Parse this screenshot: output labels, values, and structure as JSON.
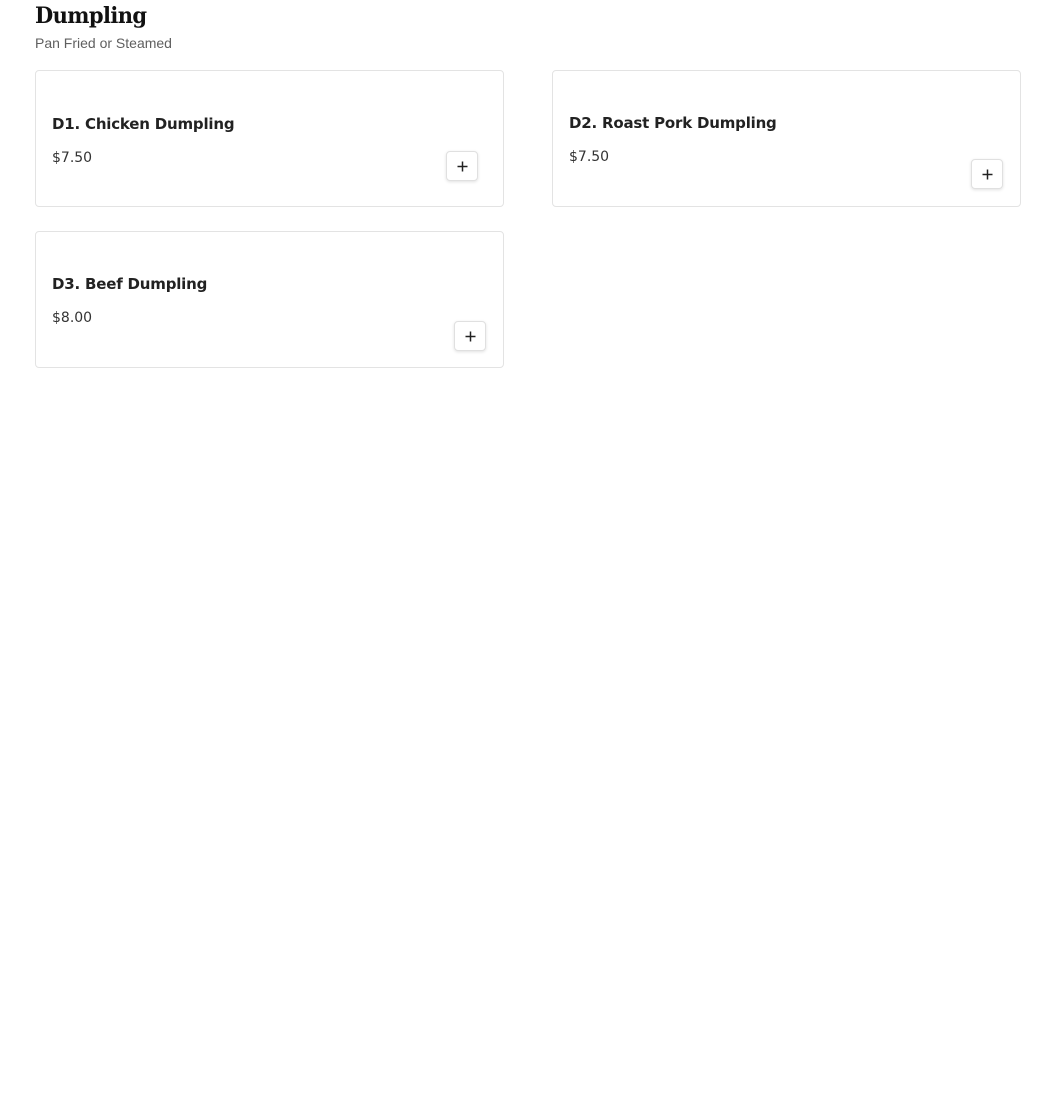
{
  "section": {
    "title": "Dumpling",
    "subtitle": "Pan Fried or Steamed"
  },
  "items": [
    {
      "name": "D1. Chicken Dumpling",
      "price": "$7.50",
      "add_icon": "plus-icon"
    },
    {
      "name": "D2. Roast Pork Dumpling",
      "price": "$7.50",
      "add_icon": "plus-icon"
    },
    {
      "name": "D3. Beef Dumpling",
      "price": "$8.00",
      "add_icon": "plus-icon"
    }
  ],
  "colors": {
    "text": "#222222",
    "subtitle": "#5f5f5f",
    "border": "#e3e3e3"
  }
}
